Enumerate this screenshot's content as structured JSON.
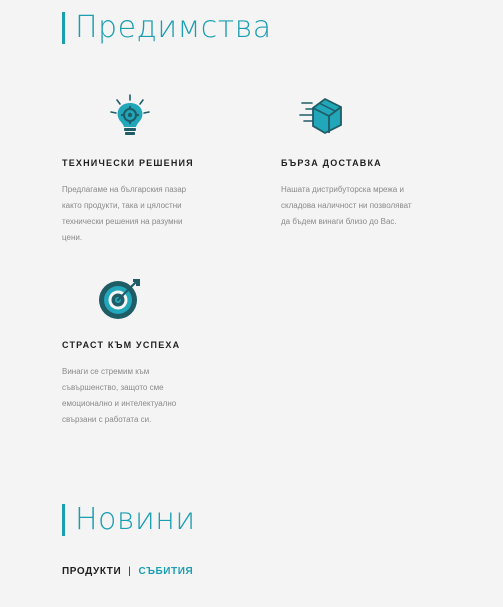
{
  "colors": {
    "accent": "#1a9fb2",
    "text": "#1f1f1f",
    "muted": "#8a8a8a",
    "background": "#f4f4f4"
  },
  "advantages": {
    "title": "Предимства",
    "features": [
      {
        "icon": "lightbulb-gear-icon",
        "title": "ТЕХНИЧЕСКИ РЕШЕНИЯ",
        "desc_lines": [
          "Предлагаме на българския пазар",
          "както продукти, така и цялостни",
          "технически решения на разумни",
          "цени."
        ]
      },
      {
        "icon": "fast-delivery-box-icon",
        "title": "БЪРЗА ДОСТАВКА",
        "desc_lines": [
          "Нашата дистрибуторска мрежа и",
          "складова наличност ни позволяват",
          "да бъдем винаги близо до Вас."
        ]
      },
      {
        "icon": "target-icon",
        "title": "СТРАСТ КЪМ УСПЕХА",
        "desc_lines": [
          "Винаги се стремим към",
          "съвършенство, защото сме",
          "емоционално и интелектуално",
          "свързани с работата си."
        ]
      }
    ]
  },
  "news": {
    "title": "Новини",
    "tabs": {
      "products": "ПРОДУКТИ",
      "separator": "|",
      "events": "СЪБИТИЯ"
    }
  }
}
